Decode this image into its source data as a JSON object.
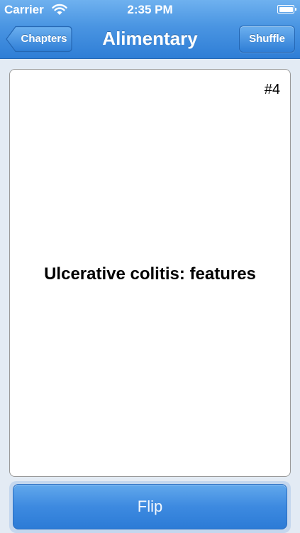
{
  "status_bar": {
    "carrier": "Carrier",
    "time": "2:35 PM",
    "wifi_icon": "wifi-icon",
    "battery_icon": "battery-icon"
  },
  "nav": {
    "back_label": "Chapters",
    "title": "Alimentary",
    "shuffle_label": "Shuffle"
  },
  "card": {
    "number": "#4",
    "text": "Ulcerative colitis: features"
  },
  "flip_label": "Flip",
  "colors": {
    "nav_blue": "#4a95e2",
    "background": "#e3ebf4",
    "card": "#ffffff"
  }
}
